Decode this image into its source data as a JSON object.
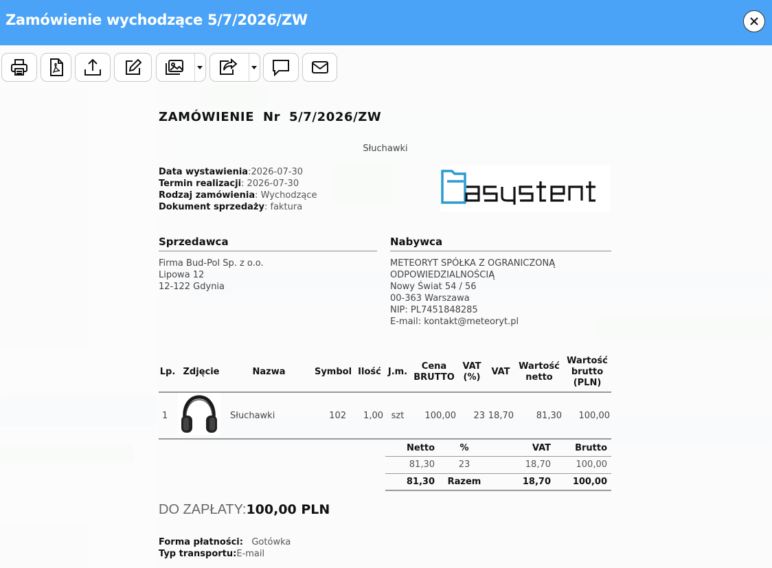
{
  "window": {
    "title": "Zamówienie wychodzące 5/7/2026/ZW"
  },
  "toolbar": {
    "icons": [
      "printer-icon",
      "pdf-icon",
      "upload-icon",
      "edit-icon",
      "gallery-icon",
      "share-icon",
      "comment-icon",
      "mail-icon"
    ]
  },
  "document": {
    "title": "ZAMÓWIENIE Nr 5/7/2026/ZW",
    "subtitle": "Słuchawki",
    "meta": [
      {
        "label": "Data wystawienia",
        "value": "2026-07-30"
      },
      {
        "label": "Termin realizacji",
        "value": "2026-07-30"
      },
      {
        "label": "Rodzaj zamówienia",
        "value": "Wychodzące"
      },
      {
        "label": "Dokument sprzedaży",
        "value": "faktura"
      }
    ],
    "logo_text": "asystent",
    "seller": {
      "heading": "Sprzedawca",
      "lines": [
        "Firma Bud-Pol Sp. z o.o.",
        "Lipowa 12",
        "12-122 Gdynia"
      ]
    },
    "buyer": {
      "heading": "Nabywca",
      "lines": [
        "METEORYT SPÓŁKA Z OGRANICZONĄ",
        "ODPOWIEDZIALNOŚCIĄ",
        "Nowy Świat 54 / 56",
        "00-363 Warszawa",
        "NIP: PL7451848285",
        "E-mail: kontakt@meteoryt.pl"
      ]
    },
    "table": {
      "headers": [
        "Lp.",
        "Zdjęcie",
        "Nazwa",
        "Symbol",
        "Ilość",
        "J.m.",
        "Cena BRUTTO",
        "VAT (%)",
        "VAT",
        "Wartość netto",
        "Wartość brutto (PLN)"
      ],
      "rows": [
        {
          "lp": "1",
          "name": "Słuchawki",
          "symbol": "102",
          "qty": "1,00",
          "unit": "szt",
          "price": "100,00",
          "vat_pct": "23",
          "vat": "18,70",
          "net": "81,30",
          "gross": "100,00"
        }
      ]
    },
    "summary": {
      "headers": [
        "Netto",
        "%",
        "VAT",
        "Brutto"
      ],
      "row": [
        "81,30",
        "23",
        "18,70",
        "100,00"
      ],
      "total": [
        "81,30",
        "Razem",
        "18,70",
        "100,00"
      ]
    },
    "to_pay": {
      "label": "DO ZAPŁATY:",
      "value": "100,00 PLN"
    },
    "payment": {
      "label": "Forma płatności:",
      "value": "Gotówka"
    },
    "transport": {
      "label": "Typ transportu:",
      "value": "E-mail"
    }
  }
}
